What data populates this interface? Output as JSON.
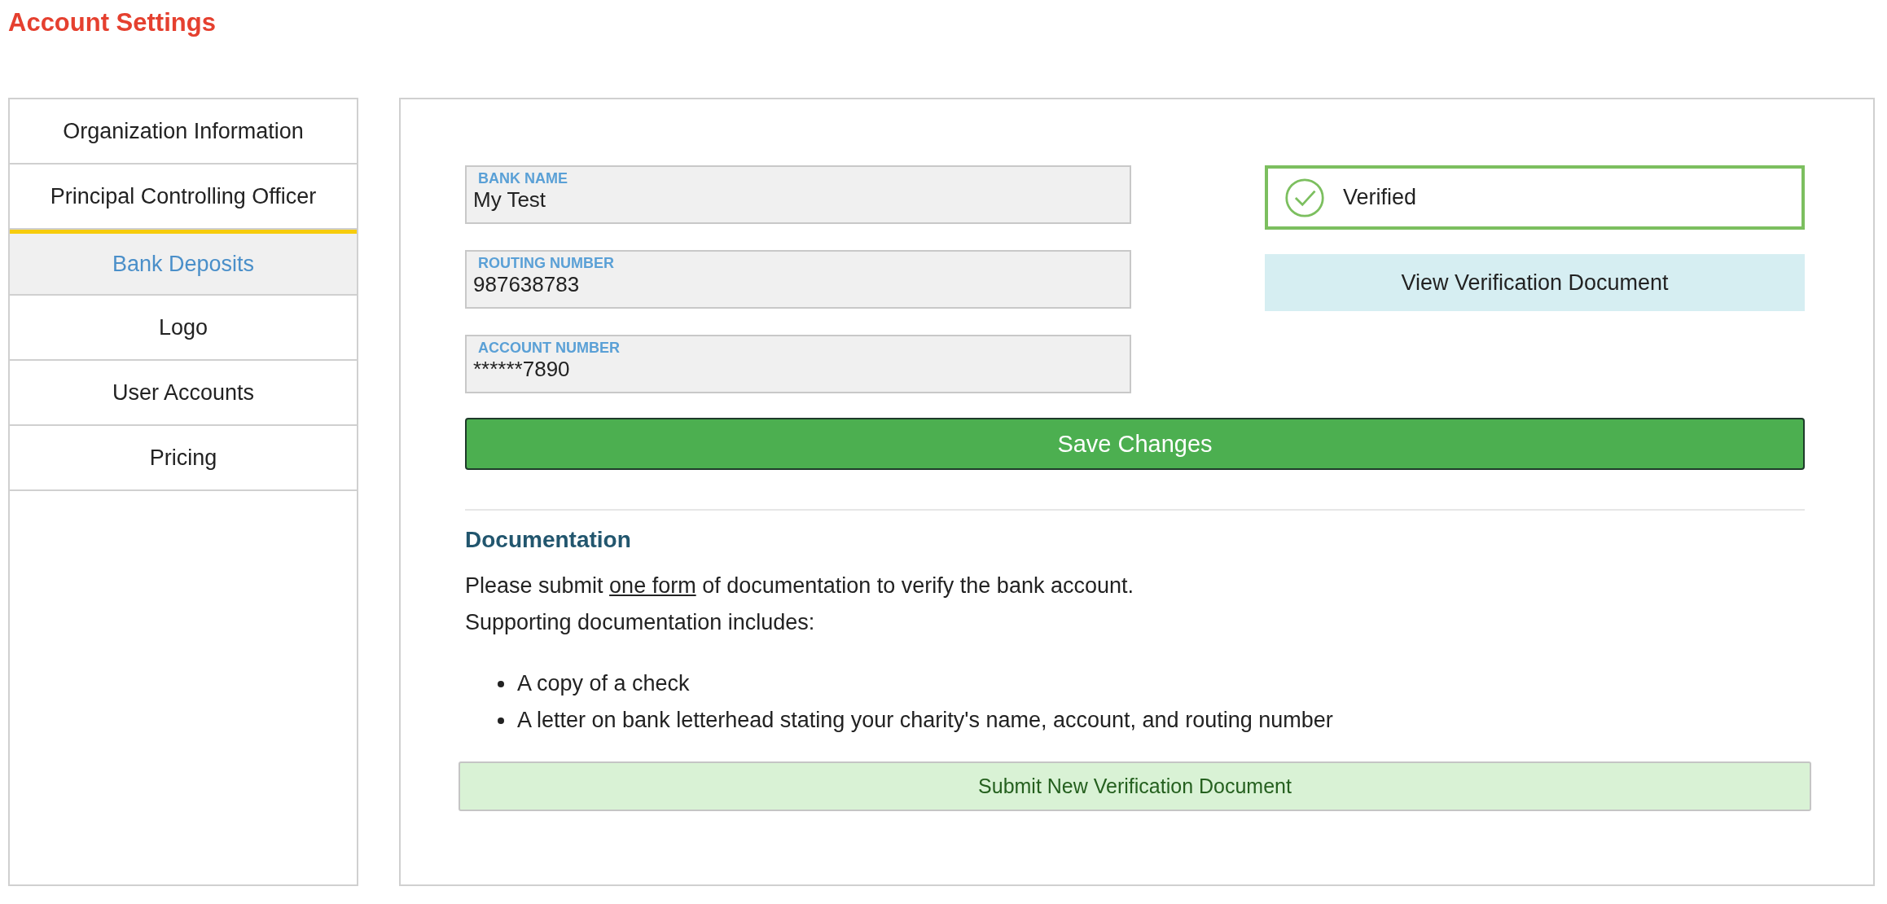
{
  "page_title": "Account Settings",
  "sidebar": {
    "items": [
      {
        "label": "Organization Information",
        "selected": false
      },
      {
        "label": "Principal Controlling Officer",
        "selected": false
      },
      {
        "label": "Bank Deposits",
        "selected": true
      },
      {
        "label": "Logo",
        "selected": false
      },
      {
        "label": "User Accounts",
        "selected": false
      },
      {
        "label": "Pricing",
        "selected": false
      }
    ]
  },
  "fields": [
    {
      "label": "BANK NAME",
      "value": "My Test"
    },
    {
      "label": "ROUTING NUMBER",
      "value": "987638783"
    },
    {
      "label": "ACCOUNT NUMBER",
      "value": "******7890"
    }
  ],
  "status": {
    "label": "Verified",
    "verified": true
  },
  "view_button": "View Verification Document",
  "save_button": "Save Changes",
  "documentation": {
    "heading": "Documentation",
    "sentence": {
      "before": "Please submit ",
      "link": "one form",
      "after": " of documentation to verify the bank account."
    },
    "intro": "Supporting documentation includes:",
    "items": [
      "A copy of a check",
      "A letter on bank letterhead stating your charity's name, account, and routing number"
    ]
  },
  "submit_button": "Submit New Verification Document"
}
